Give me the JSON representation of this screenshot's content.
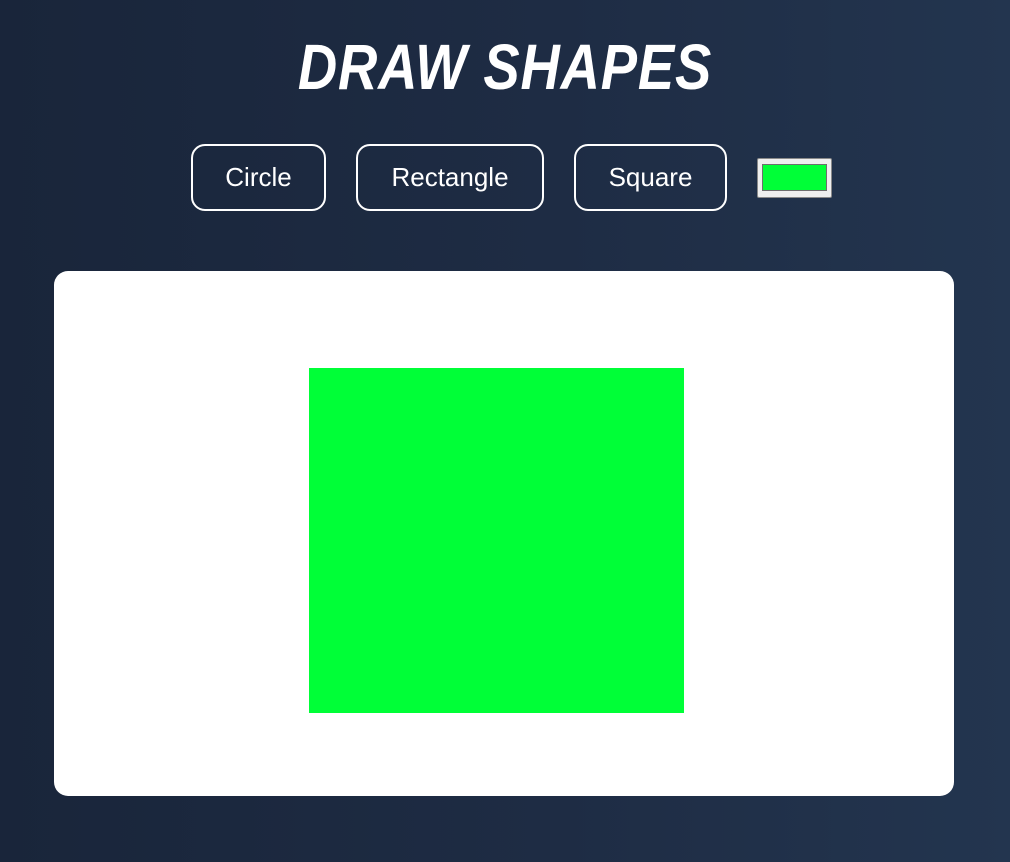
{
  "header": {
    "title": "DRAW SHAPES"
  },
  "toolbar": {
    "circle_label": "Circle",
    "rectangle_label": "Rectangle",
    "square_label": "Square",
    "selected_color": "#00ff37"
  },
  "canvas": {
    "background": "#ffffff",
    "shape_type": "square",
    "shape_color": "#00ff37"
  }
}
